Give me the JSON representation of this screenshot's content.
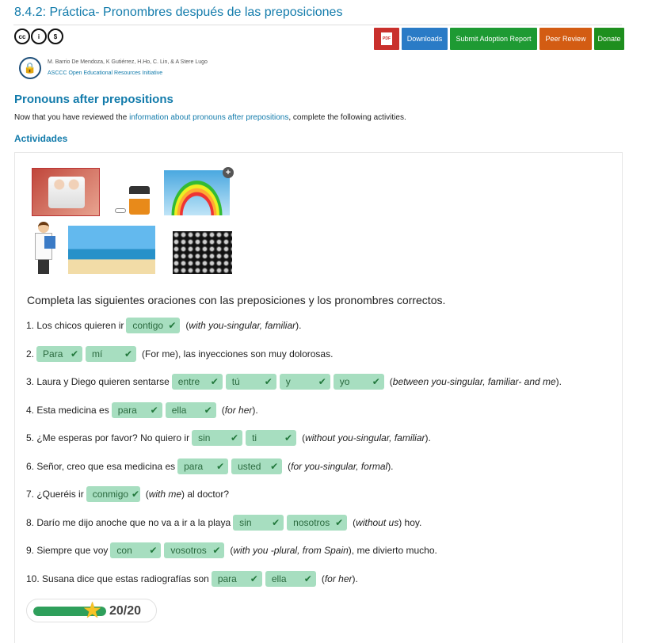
{
  "header": {
    "title": "8.4.2: Práctica- Pronombres después de las preposiciones",
    "license_icons": [
      {
        "name": "cc-icon",
        "glyph": "cc"
      },
      {
        "name": "by-icon",
        "glyph": "i"
      },
      {
        "name": "nc-icon",
        "glyph": "$"
      }
    ],
    "buttons": {
      "pdf_glyph": "PDF",
      "downloads": "Downloads",
      "adoption": "Submit Adoption Report",
      "peer_review": "Peer Review",
      "donate": "Donate"
    },
    "authors": "M. Barrio De Mendoza, K Gutiérrez, H.Ho, C. Lin, & A Stere Lugo",
    "organization": "ASCCC Open Educational Resources Initiative",
    "colors": {
      "accent": "#127bab",
      "pdf": "#c9302c",
      "downloads": "#2a7bc6",
      "adoption": "#1e9a33",
      "review": "#d35c13",
      "donate": "#1e8f1e"
    }
  },
  "content": {
    "section_title": "Pronouns after prepositions",
    "intro_before": "Now that you have reviewed the ",
    "intro_link": "information about pronouns after prepositions",
    "intro_after": ", complete the following activities.",
    "activities_title": "Actividades",
    "plus_glyph": "+",
    "instructions": "Completa las siguientes oraciones con las preposiciones y los pronombres correctos."
  },
  "questions": [
    {
      "parts": [
        "1. Los chicos quieren ir",
        {
          "answer": "contigo"
        },
        "(",
        {
          "i": "with you-singular, familiar"
        },
        ")."
      ]
    },
    {
      "parts": [
        "2.",
        {
          "answer": "Para"
        },
        {
          "answer": "mí"
        },
        "(For me), las inyecciones son muy dolorosas."
      ]
    },
    {
      "parts": [
        "3. Laura y Diego quieren sentarse",
        {
          "answer": "entre"
        },
        {
          "answer": "tú"
        },
        {
          "answer": "y"
        },
        {
          "answer": "yo"
        },
        "(",
        {
          "i": "between you-singular, familiar- and me"
        },
        ")."
      ]
    },
    {
      "parts": [
        "4. Esta medicina es",
        {
          "answer": "para"
        },
        {
          "answer": "ella"
        },
        "(",
        {
          "i": "for her"
        },
        ")."
      ]
    },
    {
      "parts": [
        "5. ¿Me esperas por favor? No quiero ir",
        {
          "answer": "sin"
        },
        {
          "answer": "ti"
        },
        "(",
        {
          "i": "without you-singular, familiar"
        },
        ")."
      ]
    },
    {
      "parts": [
        "6. Señor, creo que esa medicina es",
        {
          "answer": "para"
        },
        {
          "answer": "usted"
        },
        "(",
        {
          "i": "for you-singular, formal"
        },
        ")."
      ]
    },
    {
      "parts": [
        "7. ¿Queréis ir",
        {
          "answer": "conmigo"
        },
        "(",
        {
          "i": "with me"
        },
        ") al doctor?"
      ]
    },
    {
      "parts": [
        "8. Darío me dijo anoche que no va a ir a la playa",
        {
          "answer": "sin"
        },
        {
          "answer": "nosotros"
        },
        "(",
        {
          "i": "without us"
        },
        ") hoy."
      ]
    },
    {
      "parts": [
        "9. Siempre que voy",
        {
          "answer": "con"
        },
        {
          "answer": "vosotros"
        },
        "(",
        {
          "i": "with you -plural, from Spain"
        },
        "), me divierto mucho."
      ]
    },
    {
      "parts": [
        "10. Susana dice que estas radiografías son",
        {
          "answer": "para"
        },
        {
          "answer": "ella"
        },
        "(",
        {
          "i": "for her"
        },
        ")."
      ]
    }
  ],
  "score": {
    "text": "20/20",
    "progress": 1.0,
    "check_glyph": "✔",
    "star_glyph": "★"
  }
}
